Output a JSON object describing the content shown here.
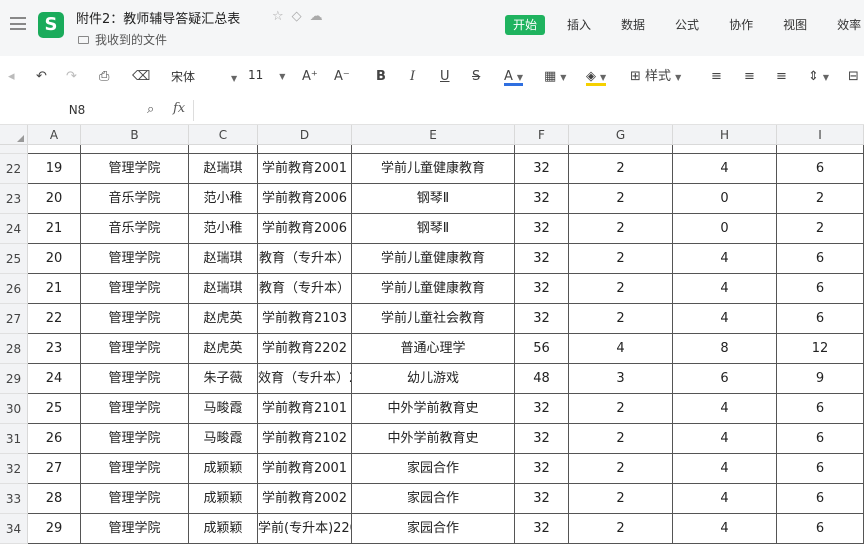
{
  "titlebar": {
    "doc_title": "附件2：教师辅导答疑汇总表",
    "folder_label": "我收到的文件",
    "menu": [
      "开始",
      "插入",
      "数据",
      "公式",
      "协作",
      "视图",
      "效率"
    ]
  },
  "toolbar": {
    "font_name": "宋体",
    "font_size": "11",
    "style_label": "样式"
  },
  "formula_bar": {
    "cell_ref": "N8",
    "fx": "fx",
    "formula": ""
  },
  "columns": [
    "A",
    "B",
    "C",
    "D",
    "E",
    "F",
    "G",
    "H",
    "I"
  ],
  "rows": [
    {
      "num": "22",
      "cells": [
        "19",
        "管理学院",
        "赵瑞琪",
        "学前教育2001",
        "学前儿童健康教育",
        "32",
        "2",
        "4",
        "6"
      ]
    },
    {
      "num": "23",
      "cells": [
        "20",
        "音乐学院",
        "范小稚",
        "学前教育2006",
        "钢琴Ⅱ",
        "32",
        "2",
        "0",
        "2"
      ]
    },
    {
      "num": "24",
      "cells": [
        "21",
        "音乐学院",
        "范小稚",
        "学前教育2006",
        "钢琴Ⅱ",
        "32",
        "2",
        "0",
        "2"
      ]
    },
    {
      "num": "25",
      "cells": [
        "20",
        "管理学院",
        "赵瑞琪",
        "教育（专升本）",
        "学前儿童健康教育",
        "32",
        "2",
        "4",
        "6"
      ]
    },
    {
      "num": "26",
      "cells": [
        "21",
        "管理学院",
        "赵瑞琪",
        "教育（专升本）",
        "学前儿童健康教育",
        "32",
        "2",
        "4",
        "6"
      ]
    },
    {
      "num": "27",
      "cells": [
        "22",
        "管理学院",
        "赵虎英",
        "学前教育2103",
        "学前儿童社会教育",
        "32",
        "2",
        "4",
        "6"
      ]
    },
    {
      "num": "28",
      "cells": [
        "23",
        "管理学院",
        "赵虎英",
        "学前教育2202",
        "普通心理学",
        "56",
        "4",
        "8",
        "12"
      ]
    },
    {
      "num": "29",
      "cells": [
        "24",
        "管理学院",
        "朱子薇",
        "效育（专升本）2",
        "幼儿游戏",
        "48",
        "3",
        "6",
        "9"
      ]
    },
    {
      "num": "30",
      "cells": [
        "25",
        "管理学院",
        "马畯霞",
        "学前教育2101",
        "中外学前教育史",
        "32",
        "2",
        "4",
        "6"
      ]
    },
    {
      "num": "31",
      "cells": [
        "26",
        "管理学院",
        "马畯霞",
        "学前教育2102",
        "中外学前教育史",
        "32",
        "2",
        "4",
        "6"
      ]
    },
    {
      "num": "32",
      "cells": [
        "27",
        "管理学院",
        "成颖颖",
        "学前教育2001",
        "家园合作",
        "32",
        "2",
        "4",
        "6"
      ]
    },
    {
      "num": "33",
      "cells": [
        "28",
        "管理学院",
        "成颖颖",
        "学前教育2002",
        "家园合作",
        "32",
        "2",
        "4",
        "6"
      ]
    },
    {
      "num": "34",
      "cells": [
        "29",
        "管理学院",
        "成颖颖",
        "学前(专升本)220",
        "家园合作",
        "32",
        "2",
        "4",
        "6"
      ]
    }
  ],
  "colors": {
    "accent": "#1fb35f",
    "logo": "#1aab5b",
    "fill_color": "#f5d000",
    "font_color": "#2f6fe0"
  }
}
